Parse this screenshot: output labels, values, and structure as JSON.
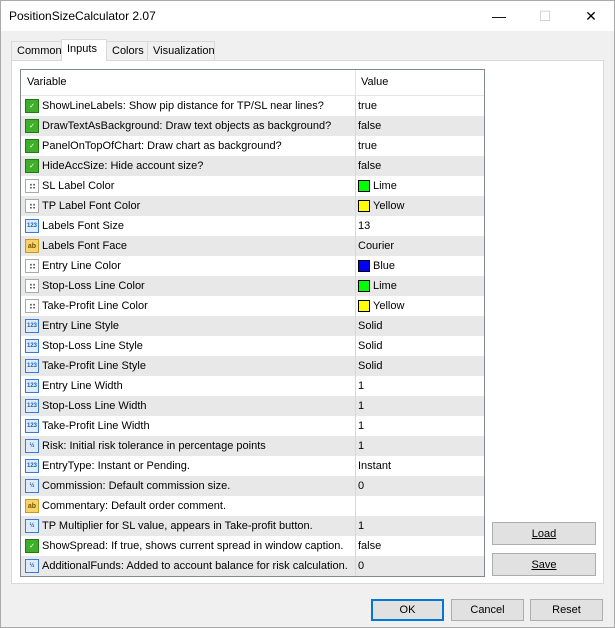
{
  "window": {
    "title": "PositionSizeCalculator 2.07",
    "minimize_glyph": "—",
    "maximize_glyph": "☐",
    "close_glyph": "✕"
  },
  "tabs": [
    {
      "label": "Common"
    },
    {
      "label": "Inputs"
    },
    {
      "label": "Colors"
    },
    {
      "label": "Visualization"
    }
  ],
  "active_tab": "Inputs",
  "grid": {
    "header_variable": "Variable",
    "header_value": "Value",
    "rows": [
      {
        "icon": "bool-icon",
        "name": "ShowLineLabels: Show pip distance for TP/SL near lines?",
        "value": "true"
      },
      {
        "icon": "bool-icon",
        "name": "DrawTextAsBackground: Draw text objects as background?",
        "value": "false"
      },
      {
        "icon": "bool-icon",
        "name": "PanelOnTopOfChart: Draw chart as background?",
        "value": "true"
      },
      {
        "icon": "bool-icon",
        "name": "HideAccSize: Hide account size?",
        "value": "false"
      },
      {
        "icon": "color-icon",
        "name": "SL Label  Color",
        "value": "Lime",
        "swatch": "#00ff00"
      },
      {
        "icon": "color-icon",
        "name": "TP Label Font Color",
        "value": "Yellow",
        "swatch": "#ffff00"
      },
      {
        "icon": "int-icon",
        "name": "Labels Font Size",
        "value": "13"
      },
      {
        "icon": "string-icon",
        "name": "Labels Font Face",
        "value": "Courier"
      },
      {
        "icon": "color-icon",
        "name": "Entry Line Color",
        "value": "Blue",
        "swatch": "#0000ff"
      },
      {
        "icon": "color-icon",
        "name": "Stop-Loss Line Color",
        "value": "Lime",
        "swatch": "#00ff00"
      },
      {
        "icon": "color-icon",
        "name": "Take-Profit Line Color",
        "value": "Yellow",
        "swatch": "#ffff00"
      },
      {
        "icon": "int-icon",
        "name": "Entry Line Style",
        "value": "Solid"
      },
      {
        "icon": "int-icon",
        "name": "Stop-Loss Line Style",
        "value": "Solid"
      },
      {
        "icon": "int-icon",
        "name": "Take-Profit Line Style",
        "value": "Solid"
      },
      {
        "icon": "int-icon",
        "name": "Entry Line Width",
        "value": "1"
      },
      {
        "icon": "int-icon",
        "name": "Stop-Loss Line Width",
        "value": "1"
      },
      {
        "icon": "int-icon",
        "name": "Take-Profit Line Width",
        "value": "1"
      },
      {
        "icon": "double-icon",
        "name": "Risk: Initial risk tolerance in percentage points",
        "value": "1"
      },
      {
        "icon": "int-icon",
        "name": "EntryType: Instant or Pending.",
        "value": "Instant"
      },
      {
        "icon": "double-icon",
        "name": "Commission: Default commission size.",
        "value": "0"
      },
      {
        "icon": "string-icon",
        "name": "Commentary: Default order comment.",
        "value": ""
      },
      {
        "icon": "double-icon",
        "name": "TP Multiplier for SL value, appears in Take-profit button.",
        "value": "1"
      },
      {
        "icon": "bool-icon",
        "name": "ShowSpread: If true, shows current spread in window caption.",
        "value": "false"
      },
      {
        "icon": "double-icon",
        "name": "AdditionalFunds: Added to account balance for risk calculation.",
        "value": "0"
      }
    ]
  },
  "buttons": {
    "load": "Load",
    "save": "Save",
    "ok": "OK",
    "cancel": "Cancel",
    "reset": "Reset"
  }
}
